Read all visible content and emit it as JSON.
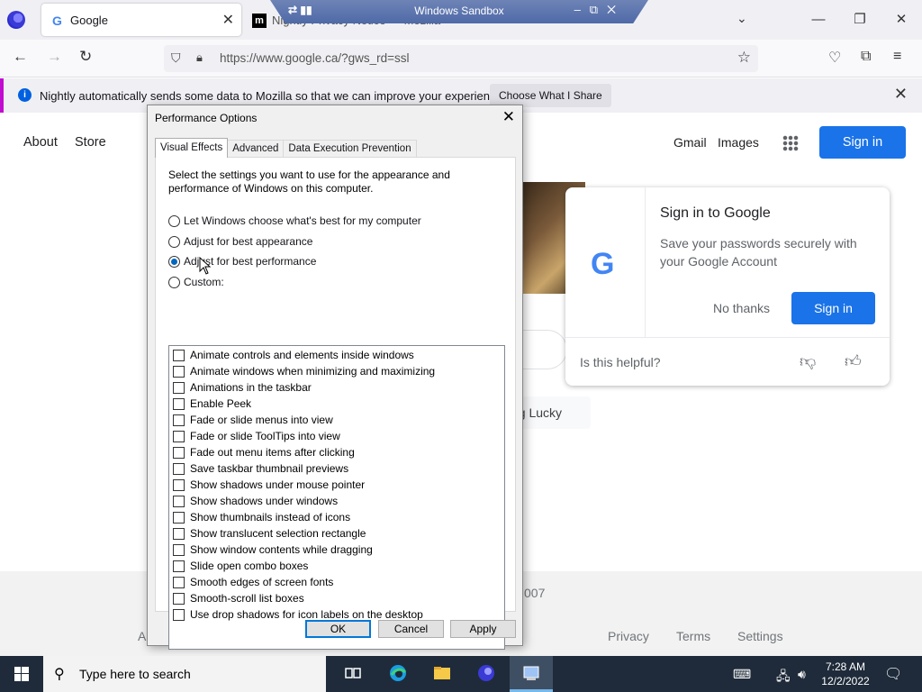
{
  "browser": {
    "tabs": [
      {
        "title": "Google",
        "favicon": "G"
      },
      {
        "title": "Nightly Privacy Notice — Mozilla",
        "favicon": "m"
      }
    ],
    "sandbox": {
      "title": "Windows Sandbox",
      "left_icons": "⇄ ▮▮"
    },
    "url": "https://www.google.ca/?gws_rd=ssl",
    "notification": {
      "text": "Nightly automatically sends some data to Mozilla so that we can improve your experience.",
      "button": "Choose What I Share"
    }
  },
  "google": {
    "left_links": [
      "About",
      "Store"
    ],
    "right_links": [
      "Gmail",
      "Images"
    ],
    "signin": "Sign in",
    "lucky_fragment": "ng Lucky",
    "footer": {
      "country_fragment": "007",
      "left_fragment": "A",
      "links": [
        "Privacy",
        "Terms",
        "Settings"
      ]
    },
    "popup": {
      "title": "Sign in to Google",
      "text": "Save your passwords securely with your Google Account",
      "no_thanks": "No thanks",
      "sign_in": "Sign in",
      "helpful": "Is this helpful?"
    }
  },
  "dialog": {
    "title": "Performance Options",
    "tabs": [
      "Visual Effects",
      "Advanced",
      "Data Execution Prevention"
    ],
    "active_tab": "Visual Effects",
    "description": "Select the settings you want to use for the appearance and performance of Windows on this computer.",
    "options": [
      {
        "label": "Let Windows choose what's best for my computer",
        "selected": false
      },
      {
        "label": "Adjust for best appearance",
        "selected": false
      },
      {
        "label": "Adjust for best performance",
        "selected": true
      },
      {
        "label": "Custom:",
        "selected": false
      }
    ],
    "effects": [
      "Animate controls and elements inside windows",
      "Animate windows when minimizing and maximizing",
      "Animations in the taskbar",
      "Enable Peek",
      "Fade or slide menus into view",
      "Fade or slide ToolTips into view",
      "Fade out menu items after clicking",
      "Save taskbar thumbnail previews",
      "Show shadows under mouse pointer",
      "Show shadows under windows",
      "Show thumbnails instead of icons",
      "Show translucent selection rectangle",
      "Show window contents while dragging",
      "Slide open combo boxes",
      "Smooth edges of screen fonts",
      "Smooth-scroll list boxes",
      "Use drop shadows for icon labels on the desktop"
    ],
    "buttons": {
      "ok": "OK",
      "cancel": "Cancel",
      "apply": "Apply"
    }
  },
  "taskbar": {
    "search_placeholder": "Type here to search",
    "time": "7:28 AM",
    "date": "12/2/2022",
    "apps": [
      "task-view-icon",
      "edge-icon",
      "file-explorer-icon",
      "firefox-nightly-icon",
      "sandbox-icon"
    ]
  },
  "colors": {
    "accent": "#1a73e8",
    "radio_selected": "#0067c0",
    "taskbar": "#1f2b3a",
    "notification_border": "#c10bd1"
  }
}
